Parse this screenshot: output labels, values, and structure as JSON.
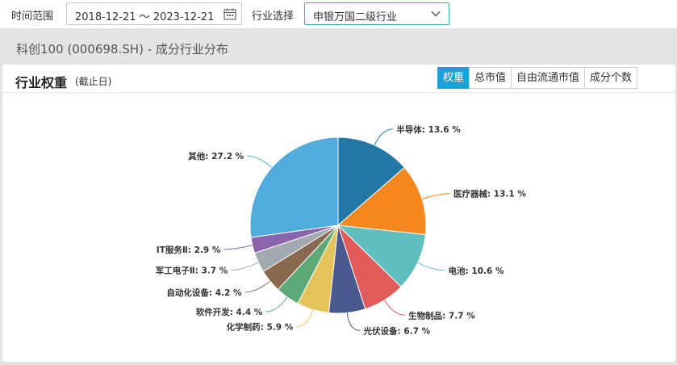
{
  "filters": {
    "time_range_label": "时间范围",
    "date_range": "2018-12-21 ～ 2023-12-21",
    "industry_label": "行业选择",
    "industry_selected": "申银万国二级行业"
  },
  "header": {
    "title": "科创100 (000698.SH) - 成分行业分布"
  },
  "card": {
    "title": "行业权重",
    "subtitle": "(截止日)",
    "tabs": [
      {
        "label": "权重",
        "active": true
      },
      {
        "label": "总市值",
        "active": false
      },
      {
        "label": "自由流通市值",
        "active": false
      },
      {
        "label": "成分个数",
        "active": false
      }
    ]
  },
  "chart_data": {
    "type": "pie",
    "slices": [
      {
        "name": "半导体",
        "value": 13.6,
        "label": "半导体: 13.6 %",
        "color": "#2377a4"
      },
      {
        "name": "医疗器械",
        "value": 13.1,
        "label": "医疗器械: 13.1 %",
        "color": "#f5871f"
      },
      {
        "name": "电池",
        "value": 10.6,
        "label": "电池: 10.6 %",
        "color": "#5fbfbf"
      },
      {
        "name": "生物制品",
        "value": 7.7,
        "label": "生物制品: 7.7 %",
        "color": "#e15b5b"
      },
      {
        "name": "光伏设备",
        "value": 6.7,
        "label": "光伏设备: 6.7 %",
        "color": "#4b5a8e"
      },
      {
        "name": "化学制药",
        "value": 5.9,
        "label": "化学制药: 5.9 %",
        "color": "#e4c35a"
      },
      {
        "name": "软件开发",
        "value": 4.4,
        "label": "软件开发: 4.4 %",
        "color": "#5fa878"
      },
      {
        "name": "自动化设备",
        "value": 4.2,
        "label": "自动化设备: 4.2 %",
        "color": "#8a6a4f"
      },
      {
        "name": "军工电子Ⅱ",
        "value": 3.7,
        "label": "军工电子Ⅱ: 3.7 %",
        "color": "#a3a9b0"
      },
      {
        "name": "IT服务Ⅱ",
        "value": 2.9,
        "label": "IT服务Ⅱ: 2.9 %",
        "color": "#8a65ad"
      },
      {
        "name": "其他",
        "value": 27.2,
        "label": "其他: 27.2 %",
        "color": "#52abdd"
      }
    ]
  }
}
